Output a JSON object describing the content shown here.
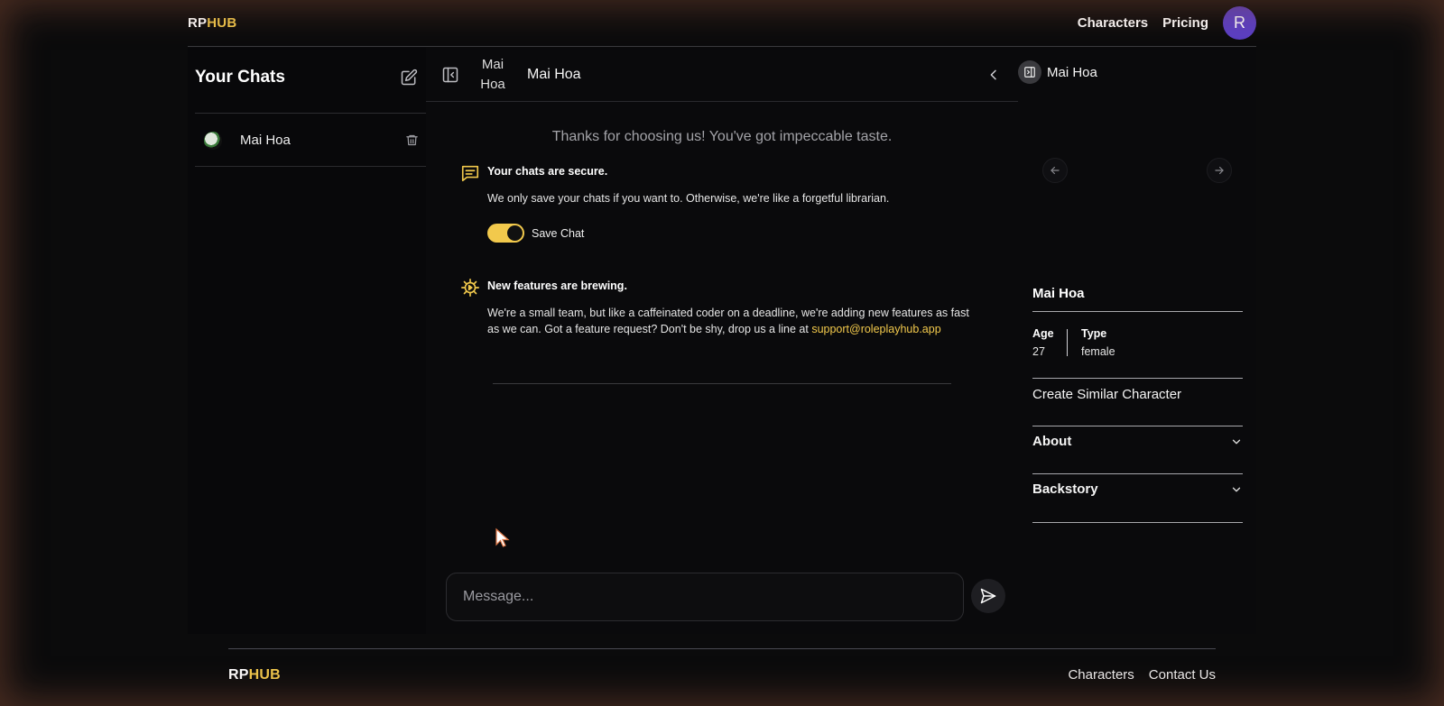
{
  "header": {
    "logo_part1": "RP",
    "logo_part2": "HUB",
    "nav": [
      "Characters",
      "Pricing"
    ],
    "avatar_initial": "R"
  },
  "sidebar": {
    "title": "Your Chats",
    "chats": [
      {
        "name": "Mai Hoa"
      }
    ]
  },
  "chat": {
    "header_avatar_alt": "Mai Hoa",
    "header_name": "Mai Hoa",
    "welcome": "Thanks for choosing us! You've got impeccable taste.",
    "secure_title": "Your chats are secure.",
    "secure_text": "We only save your chats if you want to. Otherwise, we're like a forgetful librarian.",
    "save_toggle_label": "Save Chat",
    "save_toggle_on": true,
    "features_title": "New features are brewing.",
    "features_text": "We're a small team, but like a caffeinated coder on a deadline, we're adding new features as fast as we can. Got a feature request? Don't be shy, drop us a line at ",
    "support_email": "support@roleplayhub.app",
    "input_placeholder": "Message..."
  },
  "profile": {
    "top_name": "Mai Hoa",
    "name": "Mai Hoa",
    "age_label": "Age",
    "age_value": "27",
    "type_label": "Type",
    "type_value": "female",
    "create_similar": "Create Similar Character",
    "about_label": "About",
    "backstory_label": "Backstory"
  },
  "footer": {
    "logo_part1": "RP",
    "logo_part2": "HUB",
    "links": [
      "Characters",
      "Contact Us"
    ]
  },
  "colors": {
    "accent": "#f2c94c",
    "avatar_bg": "#5b3fc4",
    "background": "#0b0b0c"
  },
  "icons": [
    "edit-icon",
    "trash-icon",
    "sidebar-collapse-icon",
    "chevron-left-icon",
    "chat-message-icon",
    "gear-icon",
    "send-icon",
    "arrow-left-icon",
    "arrow-right-icon",
    "chevron-down-icon",
    "panel-toggle-icon"
  ]
}
